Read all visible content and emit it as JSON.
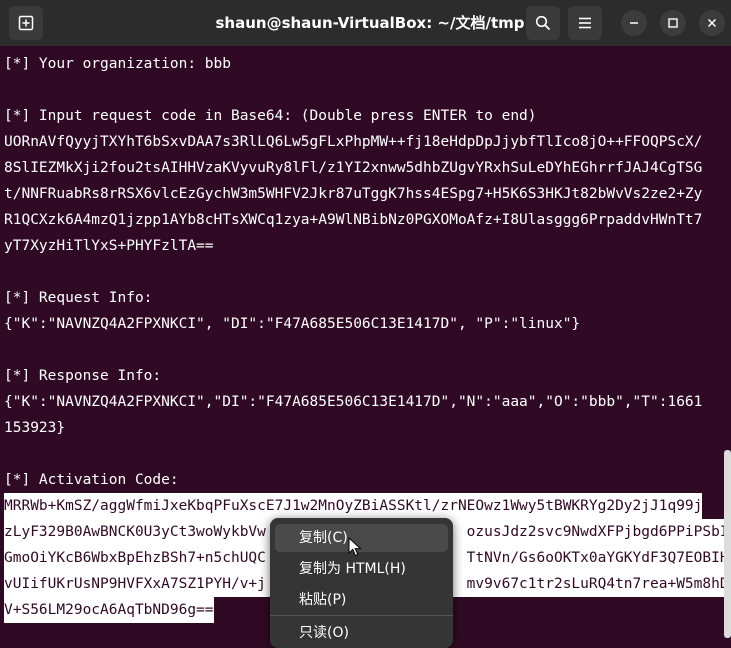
{
  "window": {
    "title": "shaun@shaun-VirtualBox: ~/文档/tmp"
  },
  "icons": {
    "new_tab": "new-tab-icon",
    "search": "search-icon",
    "menu": "hamburger-menu-icon",
    "minimize": "minimize-icon",
    "maximize": "maximize-icon",
    "close": "close-icon"
  },
  "terminal": {
    "lines": [
      "[*] Your organization: bbb",
      "",
      "[*] Input request code in Base64: (Double press ENTER to end)",
      "UORnAVfQyyjTXYhT6bSxvDAA7s3RlLQ6Lw5gFLxPhpMW++fj18eHdpDpJjybfTlIco8jO++FFOQPScX/",
      "8SlIEZMkXji2fou2tsAIHHVzaKVyvuRy8lFl/z1YI2xnww5dhbZUgvYRxhSuLeDYhEGhrrfJAJ4CgTSG",
      "t/NNFRuabRs8rRSX6vlcEzGychW3m5WHFV2Jkr87uTggK7hss4ESpg7+H5K6S3HKJt82bWvVs2ze2+Zy",
      "R1QCXzk6A4mzQ1jzpp1AYb8cHTsXWCq1zya+A9WlNBibNz0PGXOMoAfz+I8Ulasggg6PrpaddvHWnTt7",
      "yT7XyzHiTlYxS+PHYFzlTA==",
      "",
      "[*] Request Info:",
      "{\"K\":\"NAVNZQ4A2FPXNKCI\", \"DI\":\"F47A685E506C13E1417D\", \"P\":\"linux\"}",
      "",
      "[*] Response Info:",
      "{\"K\":\"NAVNZQ4A2FPXNKCI\",\"DI\":\"F47A685E506C13E1417D\",\"N\":\"aaa\",\"O\":\"bbb\",\"T\":1661",
      "153923}",
      "",
      "[*] Activation Code:",
      "MRRWb+KmSZ/aggWfmiJxeKbqPFuXscE7J1w2MnOyZBiASSKtl/zrNEOwz1Wwy5tBWKRYg2Dy2jJ1q99j",
      "zLyF329B0AwBNCK0U3yCt3woWykbVw                       ozusJdz2svc9NwdXFPjbgd6PPiPSbI",
      "GmoOiYKcB6WbxBpEhzBSh7+n5chUQC                       TtNVn/Gs6oOKTx0aYGKYdF3Q7EOBIH",
      "vUIifUKrUsNP9HVFXxA7SZ1PYH/v+j                       mv9v67c1tr2sLuRQ4tn7rea+W5m8hD",
      "V+S56LM29ocA6AqTbND96g=="
    ]
  },
  "context_menu": {
    "copy": "复制(C)",
    "copy_html": "复制为 HTML(H)",
    "paste": "粘贴(P)",
    "readonly": "只读(O)"
  }
}
